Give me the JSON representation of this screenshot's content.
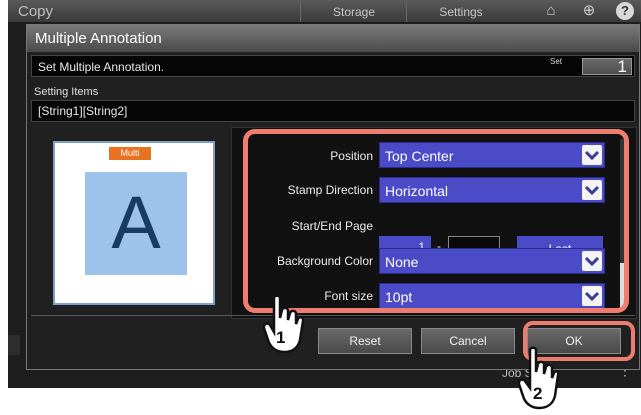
{
  "app": {
    "title": "Copy",
    "tabs": [
      "Storage",
      "Settings"
    ],
    "help_glyph": "?",
    "job_status": "Job Status"
  },
  "dialog": {
    "title": "Multiple Annotation",
    "instruction": "Set Multiple Annotation.",
    "set_label": "Set",
    "set_value": "1",
    "setting_items_label": "Setting Items",
    "setting_items_value": "[String1][String2]",
    "preview": {
      "badge": "Multi",
      "letter": "A"
    },
    "rows": {
      "position": {
        "label": "Position",
        "value": "Top Center"
      },
      "stamp_direction": {
        "label": "Stamp Direction",
        "value": "Horizontal"
      },
      "start_end_page": {
        "label": "Start/End Page",
        "start": "1",
        "separator": "-",
        "end": "-",
        "last_button": "Last"
      },
      "background_color": {
        "label": "Background Color",
        "value": "None"
      },
      "font_size": {
        "label": "Font size",
        "value": "10pt"
      }
    },
    "buttons": {
      "reset": "Reset",
      "cancel": "Cancel",
      "ok": "OK"
    }
  },
  "callouts": {
    "step1": "1",
    "step2": "2"
  },
  "colors": {
    "highlight": "#ec7d6f",
    "dropdown": "#4b4bc8",
    "badge": "#e8721f",
    "preview_page": "#9ec3ea"
  },
  "icons": [
    "home-icon",
    "globe-icon",
    "help-icon",
    "chevron-down-icon",
    "hand-pointer-icon"
  ]
}
